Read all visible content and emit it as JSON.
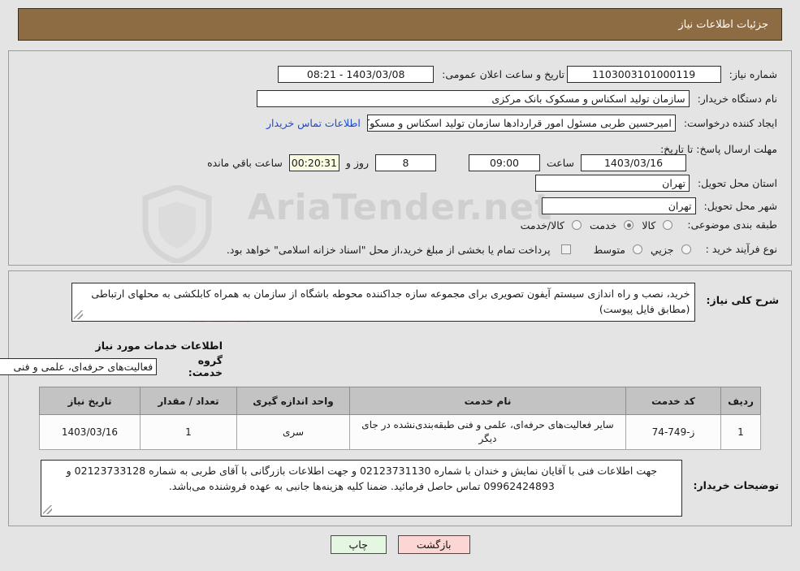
{
  "header": {
    "title": "جزئیات اطلاعات نیاز"
  },
  "watermark": {
    "text": "AriaTender.net"
  },
  "fields": {
    "need_number": {
      "label": "شماره نیاز:",
      "value": "1103003101000119"
    },
    "announce_datetime": {
      "label": "تاریخ و ساعت اعلان عمومی:",
      "value": "1403/03/08 - 08:21"
    },
    "buyer_org": {
      "label": "نام دستگاه خریدار:",
      "value": "سازمان تولید اسکناس و مسکوک بانک مرکزی"
    },
    "requester": {
      "label": "ایجاد کننده درخواست:",
      "value": "امیرحسین طربی مسئول امور قراردادها سازمان تولید اسکناس و مسکوک بانک مرکزی",
      "link": "اطلاعات تماس خریدار"
    },
    "deadline": {
      "label": "مهلت ارسال پاسخ: تا تاریخ:",
      "date": "1403/03/16",
      "time_label": "ساعت",
      "time": "09:00",
      "days": "8",
      "days_label": "روز و",
      "countdown": "00:20:31",
      "remaining_label": "ساعت باقي مانده"
    },
    "province": {
      "label": "استان محل تحویل:",
      "value": "تهران"
    },
    "city": {
      "label": "شهر محل تحویل:",
      "value": "تهران"
    },
    "category": {
      "label": "طبقه بندی موضوعی:",
      "options": [
        "کالا",
        "خدمت",
        "کالا/خدمت"
      ],
      "selected": "خدمت"
    },
    "purchase_type": {
      "label": "نوع فرآیند خرید :",
      "options": [
        "جزیي",
        "متوسط"
      ],
      "selected": "",
      "checkbox_label": "پرداخت تمام یا بخشی از مبلغ خرید،از محل \"اسناد خزانه اسلامی\" خواهد بود.",
      "checkbox_checked": false
    },
    "need_description": {
      "label": "شرح کلی نیاز:",
      "value": "خرید، نصب و راه اندازی سیستم آیفون تصویری برای مجموعه سازه جداکننده محوطه باشگاه از سازمان به همراه کابلکشی به محلهای ارتباطی (مطابق فایل پیوست)"
    },
    "service_group": {
      "label": "گروه خدمت:",
      "value": "فعالیت‌های حرفه‌ای، علمی و فنی"
    },
    "buyer_notes": {
      "label": "توضیحات خریدار:",
      "value": "جهت اطلاعات فنی با آقایان نمایش و خندان با شماره 02123731130 و جهت اطلاعات بازرگانی با آقای طربی به شماره 02123733128 و 09962424893 تماس حاصل فرمائید. ضمنا کلیه هزینه‌ها جانبی به عهده فروشنده می‌باشد."
    }
  },
  "section_heading": "اطلاعات خدمات مورد نیاز",
  "table": {
    "headers": [
      "ردیف",
      "کد خدمت",
      "نام خدمت",
      "واحد اندازه گیری",
      "تعداد / مقدار",
      "تاریخ نیاز"
    ],
    "rows": [
      {
        "row_no": "1",
        "service_code": "ز-749-74",
        "service_name": "سایر فعالیت‌های حرفه‌ای، علمی و فنی طبقه‌بندی‌نشده در جای دیگر",
        "unit": "سری",
        "quantity": "1",
        "need_date": "1403/03/16"
      }
    ]
  },
  "buttons": {
    "print": "چاپ",
    "back": "بازگشت"
  },
  "colors": {
    "header_bg": "#8d6c43",
    "page_bg": "#e4e4e4",
    "link": "#1b49d2",
    "timer_bg": "#fbfbe2",
    "table_header_bg": "#c3c3c3",
    "print_btn_bg": "#e5f7e3",
    "back_btn_bg": "#fbd6d2"
  }
}
